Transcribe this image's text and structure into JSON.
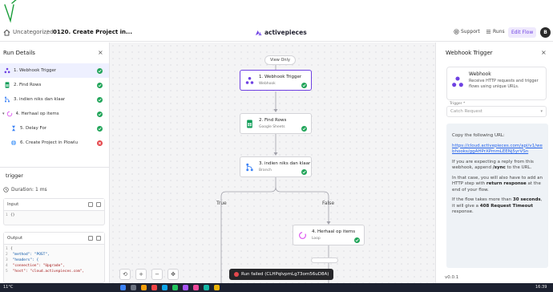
{
  "header": {
    "breadcrumb_folder": "Uncategorized",
    "breadcrumb_sep": "/",
    "flow_name": "0120. Create Project in...",
    "brand": "activepieces",
    "support": "Support",
    "runs": "Runs",
    "edit_flow": "Edit Flow",
    "avatar": "B"
  },
  "run_details": {
    "title": "Run Details",
    "close": "×",
    "steps": [
      {
        "label": "1. Webhook Trigger",
        "icon": "webhook-icon",
        "status": "success"
      },
      {
        "label": "2. Find Rows",
        "icon": "google-sheets-icon",
        "status": "success"
      },
      {
        "label": "3. indien niks dan klaar",
        "icon": "branch-icon",
        "status": "success"
      },
      {
        "label": "4. Herhaal op items",
        "icon": "loop-icon",
        "status": "success"
      },
      {
        "label": "5. Delay For",
        "icon": "hourglass-icon",
        "status": "success"
      },
      {
        "label": "6. Create Project in Plowlu",
        "icon": "globe-icon",
        "status": "failed"
      }
    ],
    "selected_step": "trigger",
    "duration": "Duration:  1 ms",
    "input_label": "Input",
    "input_code": [
      "{}"
    ],
    "output_label": "Output",
    "output_code": [
      "{",
      "  \"method\": \"POST\",",
      "  \"headers\": {",
      "    \"connection\": \"Upgrade\",",
      "    \"host\": \"cloud.activepieces.com\","
    ]
  },
  "canvas": {
    "view_only": "View Only",
    "nodes": [
      {
        "title": "1. Webhook Trigger",
        "subtitle": "Webhook"
      },
      {
        "title": "2. Find Rows",
        "subtitle": "Google Sheets"
      },
      {
        "title": "3. indien niks dan klaar",
        "subtitle": "Branch"
      },
      {
        "title": "4. Herhaal op items",
        "subtitle": "Loop"
      }
    ],
    "branch_true": "True",
    "branch_false": "False",
    "toast": "Run failed (CLHPqIvpmLg73om56uD8A)"
  },
  "right_panel": {
    "title": "Webhook Trigger",
    "close": "×",
    "piece_name": "Webhook",
    "piece_desc": "Receive HTTP requests and trigger flows using unique URLs.",
    "trigger_label": "Trigger *",
    "trigger_value": "Catch Request",
    "copy_text": "Copy the following URL:",
    "url": "https://cloud.activepieces.com/api/v1/webhooks/ggAHPrXPmmLEENj5yrVSn",
    "reply_text_1": "If you are expecting a reply from this webhook, append ",
    "reply_sync": "/sync",
    "reply_text_2": " to the URL.",
    "http_text_1": "In that case, you will also have to add an HTTP step with ",
    "http_bold": "return response",
    "http_text_2": " at the end of your flow.",
    "timeout_text_1": "If the flow takes more than ",
    "timeout_bold_1": "30 seconds",
    "timeout_text_2": ", it will give a ",
    "timeout_bold_2": "408 Request Timeout",
    "timeout_text_3": " response.",
    "version": "v0.0.1"
  },
  "taskbar": {
    "weather": "11°C",
    "clock": "16:39"
  },
  "colors": {
    "accent": "#6e41e2",
    "success": "#22a55a",
    "error": "#e5484d",
    "annotation": "#1a9e3a"
  }
}
